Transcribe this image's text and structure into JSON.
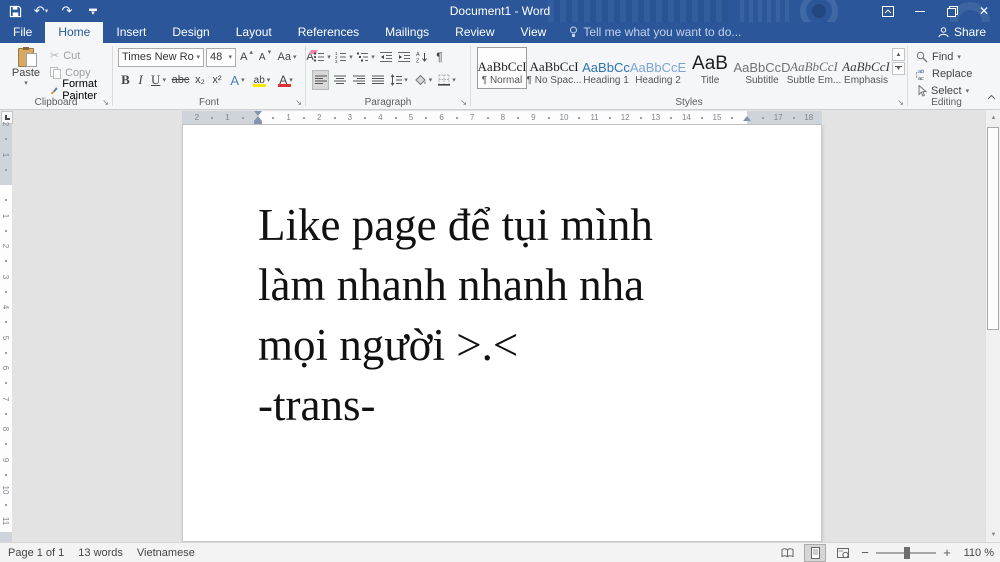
{
  "titlebar": {
    "title": "Document1 - Word"
  },
  "tabs": {
    "file": "File",
    "items": [
      "Home",
      "Insert",
      "Design",
      "Layout",
      "References",
      "Mailings",
      "Review",
      "View"
    ],
    "tell_me": "Tell me what you want to do...",
    "share": "Share"
  },
  "ribbon": {
    "clipboard": {
      "label": "Clipboard",
      "paste": "Paste",
      "cut": "Cut",
      "copy": "Copy",
      "format_painter": "Format Painter"
    },
    "font": {
      "label": "Font",
      "font_name": "Times New Ro",
      "font_size": "48",
      "bold": "B",
      "italic": "I",
      "underline": "U",
      "strike": "abc",
      "subscript": "x₂",
      "superscript": "x²",
      "change_case": "Aa",
      "grow": "A",
      "shrink": "A",
      "effects": "A",
      "highlight": "ab",
      "font_color": "A"
    },
    "paragraph": {
      "label": "Paragraph",
      "pilcrow": "¶"
    },
    "styles": {
      "label": "Styles",
      "items": [
        {
          "preview": "AaBbCcI",
          "name": "¶ Normal"
        },
        {
          "preview": "AaBbCcI",
          "name": "¶ No Spac..."
        },
        {
          "preview": "AaBbCc",
          "name": "Heading 1"
        },
        {
          "preview": "AaBbCcE",
          "name": "Heading 2"
        },
        {
          "preview": "AaB",
          "name": "Title"
        },
        {
          "preview": "AaBbCcD",
          "name": "Subtitle"
        },
        {
          "preview": "AaBbCcI",
          "name": "Subtle Em..."
        },
        {
          "preview": "AaBbCcI",
          "name": "Emphasis"
        }
      ]
    },
    "editing": {
      "label": "Editing",
      "find": "Find",
      "replace": "Replace",
      "select": "Select"
    }
  },
  "ruler": {
    "h_labels": [
      {
        "cm": -2,
        "t": "2"
      },
      {
        "cm": -1,
        "t": "1"
      },
      {
        "cm": 1,
        "t": "1"
      },
      {
        "cm": 2,
        "t": "2"
      },
      {
        "cm": 3,
        "t": "3"
      },
      {
        "cm": 4,
        "t": "4"
      },
      {
        "cm": 5,
        "t": "5"
      },
      {
        "cm": 6,
        "t": "6"
      },
      {
        "cm": 7,
        "t": "7"
      },
      {
        "cm": 8,
        "t": "8"
      },
      {
        "cm": 9,
        "t": "9"
      },
      {
        "cm": 10,
        "t": "10"
      },
      {
        "cm": 11,
        "t": "11"
      },
      {
        "cm": 12,
        "t": "12"
      },
      {
        "cm": 13,
        "t": "13"
      },
      {
        "cm": 14,
        "t": "14"
      },
      {
        "cm": 15,
        "t": "15"
      },
      {
        "cm": 17,
        "t": "17"
      },
      {
        "cm": 18,
        "t": "18"
      }
    ],
    "v_labels": [
      {
        "cm": -2,
        "t": "2"
      },
      {
        "cm": -1,
        "t": "1"
      },
      {
        "cm": 1,
        "t": "1"
      },
      {
        "cm": 2,
        "t": "2"
      },
      {
        "cm": 3,
        "t": "3"
      },
      {
        "cm": 4,
        "t": "4"
      },
      {
        "cm": 5,
        "t": "5"
      },
      {
        "cm": 6,
        "t": "6"
      },
      {
        "cm": 7,
        "t": "7"
      },
      {
        "cm": 8,
        "t": "8"
      },
      {
        "cm": 9,
        "t": "9"
      },
      {
        "cm": 10,
        "t": "10"
      },
      {
        "cm": 11,
        "t": "11"
      }
    ]
  },
  "document": {
    "lines": [
      "Like page để tụi mình",
      "làm nhanh nhanh nha",
      "mọi người >.<",
      "-trans-"
    ]
  },
  "statusbar": {
    "page": "Page 1 of 1",
    "words": "13 words",
    "language": "Vietnamese",
    "zoom": "110 %"
  }
}
